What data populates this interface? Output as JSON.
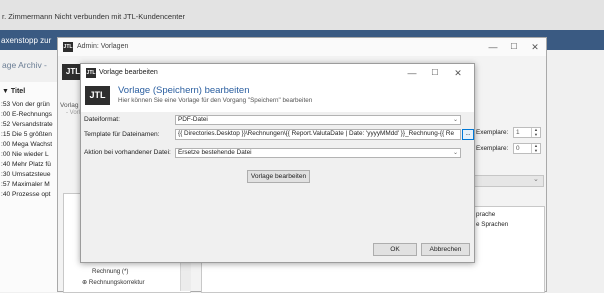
{
  "main_app": {
    "title": "r. Zimmermann Nicht verbunden mit JTL-Kundencenter",
    "banner_text": "axenstopp zur",
    "archive_label": "age Archiv -",
    "list_header": "Titel",
    "rows": [
      {
        "time": ":53",
        "text": "Von der grün"
      },
      {
        "time": ":00",
        "text": "E-Rechnungs"
      },
      {
        "time": ":52",
        "text": "Versandstrate"
      },
      {
        "time": ":15",
        "text": "Die 5 größten"
      },
      {
        "time": ":00",
        "text": "Mega Wachst"
      },
      {
        "time": ":00",
        "text": "Nie wieder L"
      },
      {
        "time": ":40",
        "text": "Mehr Platz fü"
      },
      {
        "time": ":30",
        "text": "Umsatzsteue"
      },
      {
        "time": ":57",
        "text": "Maximaler M"
      },
      {
        "time": ":40",
        "text": "Prozesse opt"
      }
    ]
  },
  "admin_window": {
    "title": "Admin: Vorlagen",
    "logo": "JTL",
    "tab_label": "Vorlag",
    "sub_label": "- Vorl",
    "tree_items": [
      "Rechnung (*)",
      "Rechnungskorrektur"
    ],
    "panel_items": [
      "prache",
      "e Sprachen"
    ],
    "exemplare_label_1": "Exemplare:",
    "exemplare_value_1": "1",
    "exemplare_label_2": "Exemplare:",
    "exemplare_value_2": "0"
  },
  "dialog": {
    "title": "Vorlage bearbeiten",
    "logo": "JTL",
    "heading": "Vorlage (Speichern) bearbeiten",
    "subheading": "Hier können Sie eine Vorlage für den Vorgang \"Speichern\" bearbeiten",
    "fields": {
      "file_format_label": "Dateiformat:",
      "file_format_value": "PDF-Datei",
      "filename_template_label": "Template für Dateinamen:",
      "filename_template_value": "{{ Directories.Desktop }}\\Rechnungen\\{{ Report.ValutaDate | Date: 'yyyyMMdd' }}_Rechnung-{{ Re",
      "existing_file_label": "Aktion bei vorhandener Datei:",
      "existing_file_value": "Ersetze bestehende Datei"
    },
    "buttons": {
      "browse": "...",
      "edit_template": "Vorlage bearbeiten",
      "ok": "OK",
      "cancel": "Abbrechen"
    }
  },
  "window_controls": {
    "minimize": "—",
    "maximize": "☐",
    "close": "✕"
  }
}
